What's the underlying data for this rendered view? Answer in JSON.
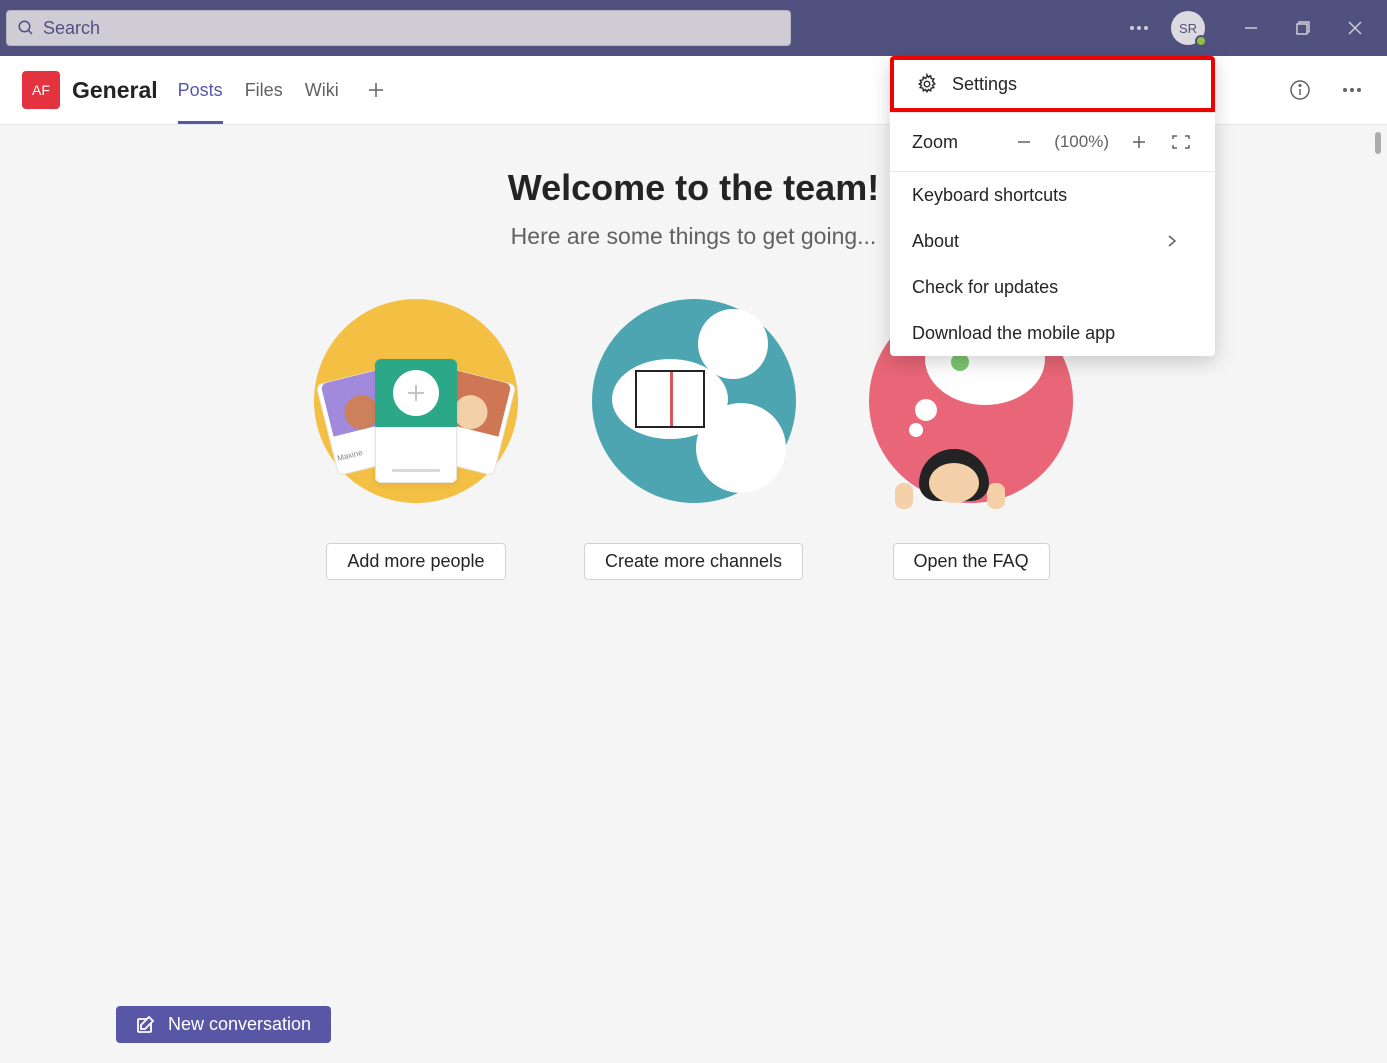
{
  "titlebar": {
    "search_placeholder": "Search",
    "avatar_initials": "SR"
  },
  "header": {
    "team_tile": "AF",
    "channel_name": "General",
    "tabs": [
      {
        "label": "Posts",
        "active": true
      },
      {
        "label": "Files",
        "active": false
      },
      {
        "label": "Wiki",
        "active": false
      }
    ]
  },
  "dropdown": {
    "settings_label": "Settings",
    "zoom_label": "Zoom",
    "zoom_pct": "(100%)",
    "keyboard_label": "Keyboard shortcuts",
    "about_label": "About",
    "updates_label": "Check for updates",
    "mobile_label": "Download the mobile app"
  },
  "welcome": {
    "title": "Welcome to the team!",
    "subtitle": "Here are some things to get going...",
    "card1_name": "Maxine",
    "card1_btn": "Add more people",
    "card2_btn": "Create more channels",
    "card3_btn": "Open the FAQ"
  },
  "new_convo": "New conversation",
  "colors": {
    "brand": "#5857a6",
    "titlebar": "#50517f",
    "accent_red": "#e2333f"
  }
}
